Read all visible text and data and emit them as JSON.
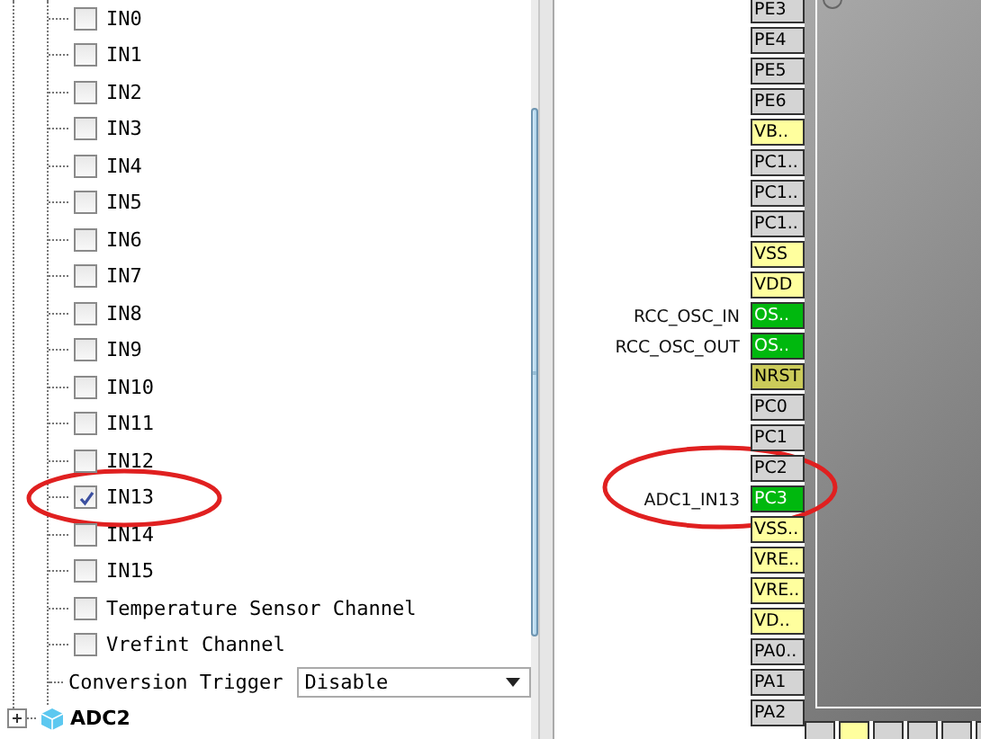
{
  "channel_tree": {
    "channels": [
      {
        "label": "IN0",
        "checked": false
      },
      {
        "label": "IN1",
        "checked": false
      },
      {
        "label": "IN2",
        "checked": false
      },
      {
        "label": "IN3",
        "checked": false
      },
      {
        "label": "IN4",
        "checked": false
      },
      {
        "label": "IN5",
        "checked": false
      },
      {
        "label": "IN6",
        "checked": false
      },
      {
        "label": "IN7",
        "checked": false
      },
      {
        "label": "IN8",
        "checked": false
      },
      {
        "label": "IN9",
        "checked": false
      },
      {
        "label": "IN10",
        "checked": false
      },
      {
        "label": "IN11",
        "checked": false
      },
      {
        "label": "IN12",
        "checked": false
      },
      {
        "label": "IN13",
        "checked": true
      },
      {
        "label": "IN14",
        "checked": false
      },
      {
        "label": "IN15",
        "checked": false
      },
      {
        "label": "Temperature Sensor Channel",
        "checked": false
      },
      {
        "label": "Vrefint Channel",
        "checked": false
      }
    ],
    "conversion_trigger": {
      "label": "Conversion Trigger",
      "value": "Disable"
    },
    "next_node": {
      "label": "ADC2",
      "expanded": false
    }
  },
  "pinout": {
    "pins": [
      {
        "name": "PE3",
        "kind": "io"
      },
      {
        "name": "PE4",
        "kind": "io"
      },
      {
        "name": "PE5",
        "kind": "io"
      },
      {
        "name": "PE6",
        "kind": "io"
      },
      {
        "name": "VB..",
        "kind": "power"
      },
      {
        "name": "PC1..",
        "kind": "io"
      },
      {
        "name": "PC1..",
        "kind": "io"
      },
      {
        "name": "PC1..",
        "kind": "io"
      },
      {
        "name": "VSS",
        "kind": "power"
      },
      {
        "name": "VDD",
        "kind": "power"
      },
      {
        "name": "OS..",
        "kind": "assigned",
        "signal": "RCC_OSC_IN"
      },
      {
        "name": "OS..",
        "kind": "assigned",
        "signal": "RCC_OSC_OUT"
      },
      {
        "name": "NRST",
        "kind": "reset"
      },
      {
        "name": "PC0",
        "kind": "io"
      },
      {
        "name": "PC1",
        "kind": "io"
      },
      {
        "name": "PC2",
        "kind": "io"
      },
      {
        "name": "PC3",
        "kind": "assigned",
        "signal": "ADC1_IN13"
      },
      {
        "name": "VSS..",
        "kind": "power"
      },
      {
        "name": "VRE..",
        "kind": "power"
      },
      {
        "name": "VRE..",
        "kind": "power"
      },
      {
        "name": "VD..",
        "kind": "power"
      },
      {
        "name": "PA0..",
        "kind": "io"
      },
      {
        "name": "PA1",
        "kind": "io"
      },
      {
        "name": "PA2",
        "kind": "io"
      }
    ]
  }
}
